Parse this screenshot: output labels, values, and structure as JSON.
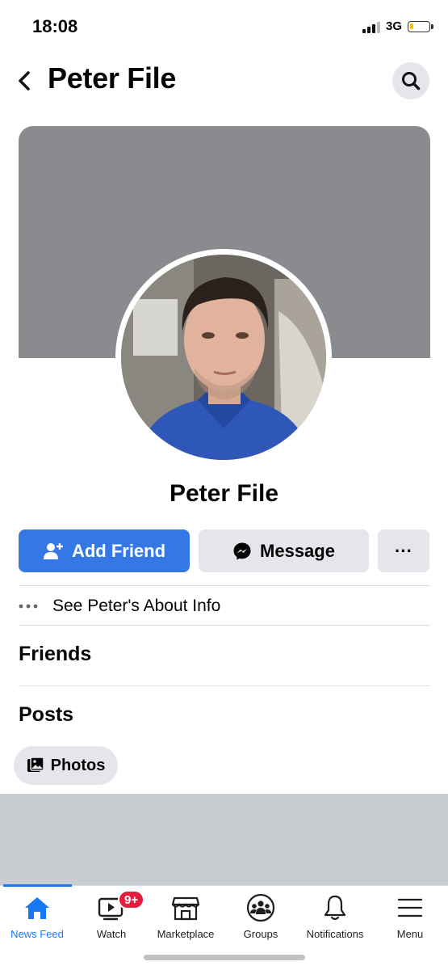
{
  "status_bar": {
    "time": "18:08",
    "network": "3G"
  },
  "header": {
    "title": "Peter File"
  },
  "profile": {
    "name": "Peter File"
  },
  "actions": {
    "add_friend": "Add Friend",
    "message": "Message",
    "more": "···"
  },
  "about": {
    "link": "See Peter's About Info"
  },
  "sections": {
    "friends": "Friends",
    "posts": "Posts"
  },
  "filters": {
    "photos": "Photos"
  },
  "tabs": [
    {
      "label": "News Feed",
      "icon": "home-icon",
      "active": true
    },
    {
      "label": "Watch",
      "icon": "watch-icon",
      "badge": "9+"
    },
    {
      "label": "Marketplace",
      "icon": "marketplace-icon"
    },
    {
      "label": "Groups",
      "icon": "groups-icon"
    },
    {
      "label": "Notifications",
      "icon": "bell-icon"
    },
    {
      "label": "Menu",
      "icon": "menu-icon"
    }
  ],
  "colors": {
    "accent": "#1877f2",
    "button_blue": "#3578e5",
    "cover": "#898b8f",
    "badge": "#e41e3f"
  }
}
